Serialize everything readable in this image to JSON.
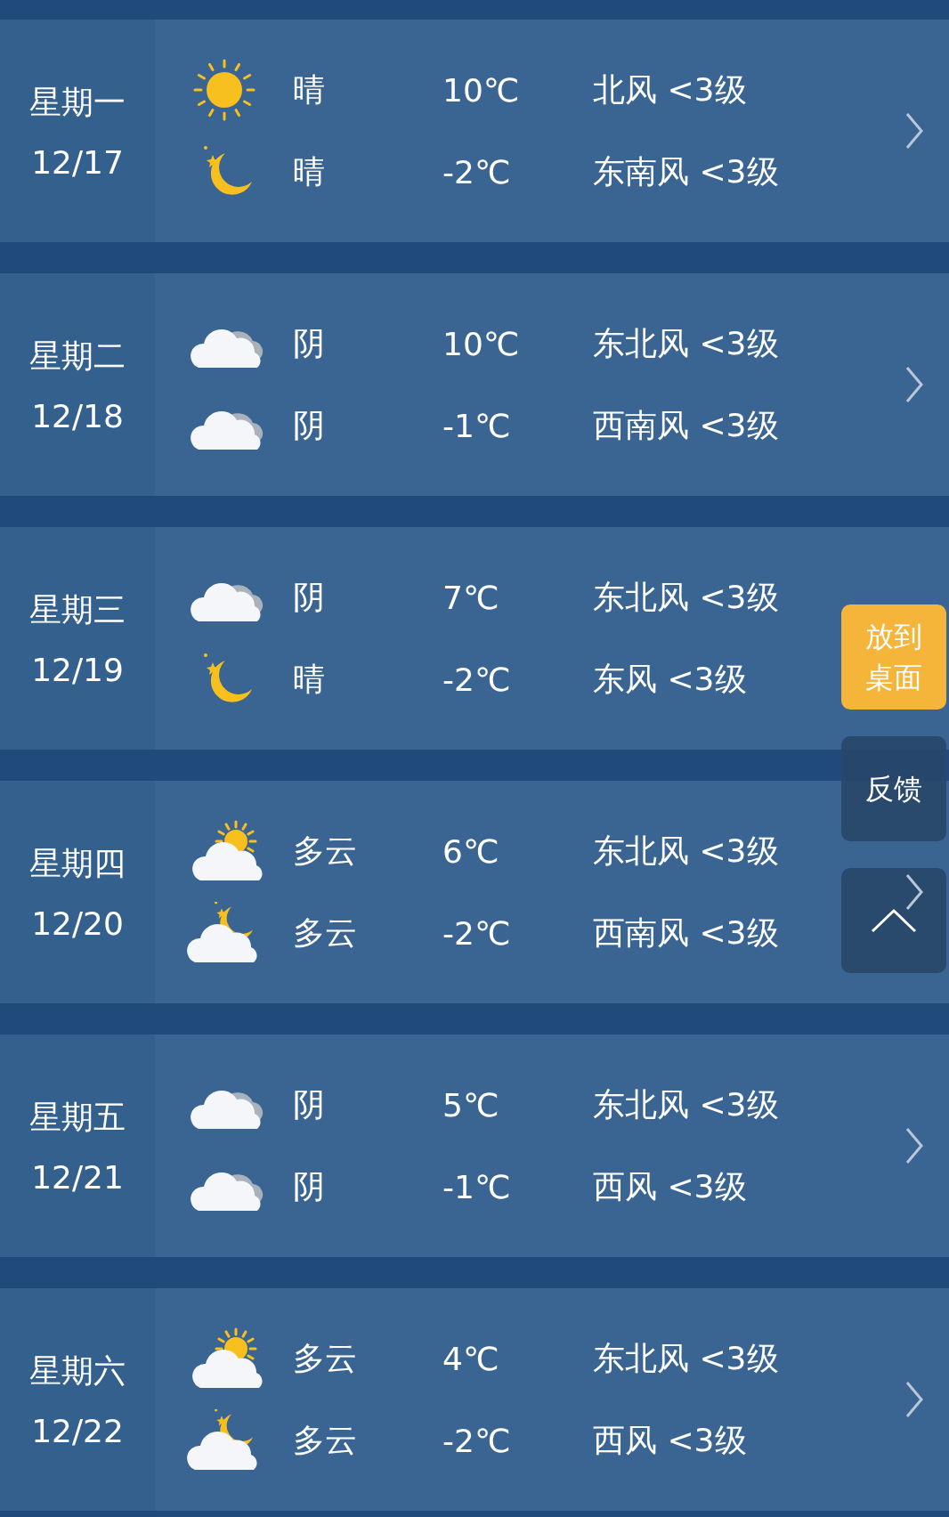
{
  "days": [
    {
      "weekday": "星期一",
      "date": "12/17",
      "chevron": true,
      "periods": [
        {
          "kind": "sunny",
          "condition": "晴",
          "temp": "10℃",
          "wind": "北风 <3级"
        },
        {
          "kind": "clear-night",
          "condition": "晴",
          "temp": "-2℃",
          "wind": "东南风 <3级"
        }
      ]
    },
    {
      "weekday": "星期二",
      "date": "12/18",
      "chevron": true,
      "periods": [
        {
          "kind": "overcast",
          "condition": "阴",
          "temp": "10℃",
          "wind": "东北风 <3级"
        },
        {
          "kind": "overcast",
          "condition": "阴",
          "temp": "-1℃",
          "wind": "西南风 <3级"
        }
      ]
    },
    {
      "weekday": "星期三",
      "date": "12/19",
      "chevron": false,
      "periods": [
        {
          "kind": "overcast",
          "condition": "阴",
          "temp": "7℃",
          "wind": "东北风 <3级"
        },
        {
          "kind": "clear-night",
          "condition": "晴",
          "temp": "-2℃",
          "wind": "东风 <3级"
        }
      ]
    },
    {
      "weekday": "星期四",
      "date": "12/20",
      "chevron": true,
      "periods": [
        {
          "kind": "partly-cloudy-day",
          "condition": "多云",
          "temp": "6℃",
          "wind": "东北风 <3级"
        },
        {
          "kind": "partly-cloudy-night",
          "condition": "多云",
          "temp": "-2℃",
          "wind": "西南风 <3级"
        }
      ]
    },
    {
      "weekday": "星期五",
      "date": "12/21",
      "chevron": true,
      "periods": [
        {
          "kind": "overcast",
          "condition": "阴",
          "temp": "5℃",
          "wind": "东北风 <3级"
        },
        {
          "kind": "overcast",
          "condition": "阴",
          "temp": "-1℃",
          "wind": "西风 <3级"
        }
      ]
    },
    {
      "weekday": "星期六",
      "date": "12/22",
      "chevron": true,
      "periods": [
        {
          "kind": "partly-cloudy-day",
          "condition": "多云",
          "temp": "4℃",
          "wind": "东北风 <3级"
        },
        {
          "kind": "partly-cloudy-night",
          "condition": "多云",
          "temp": "-2℃",
          "wind": "西风 <3级"
        }
      ]
    }
  ],
  "float_buttons": [
    {
      "kind": "add-to-desktop",
      "label": "放到桌面"
    },
    {
      "kind": "feedback",
      "label": "反馈"
    },
    {
      "kind": "scroll-top"
    }
  ]
}
